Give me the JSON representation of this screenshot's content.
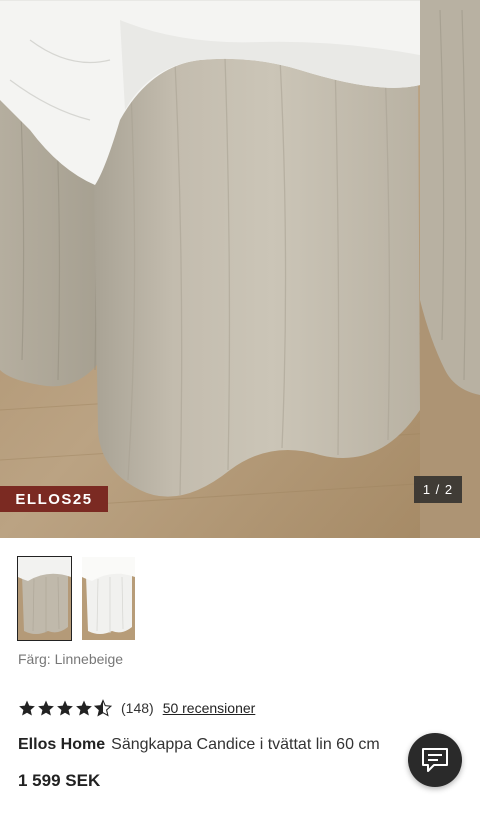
{
  "carousel": {
    "promo_code": "ELLOS25",
    "counter": "1 / 2",
    "current_index": 1,
    "total": 2
  },
  "thumbnails": [
    {
      "name": "linen-beige",
      "selected": true
    },
    {
      "name": "white",
      "selected": false
    }
  ],
  "product": {
    "color_line": "Färg: Linnebeige",
    "rating": 4.5,
    "rating_count": "(148)",
    "reviews_label": "50 recensioner",
    "brand": "Ellos Home",
    "name": "Sängkappa Candice i tvättat lin 60 cm",
    "price": "1 599 SEK"
  },
  "colors": {
    "linen": "#bfb8aa",
    "floor": "#b49a78",
    "promo_badge": "#7b2a22",
    "chat_button": "#2a2a2a"
  },
  "icons": {
    "chat": "chat-bubble-icon",
    "star": "star-icon"
  }
}
